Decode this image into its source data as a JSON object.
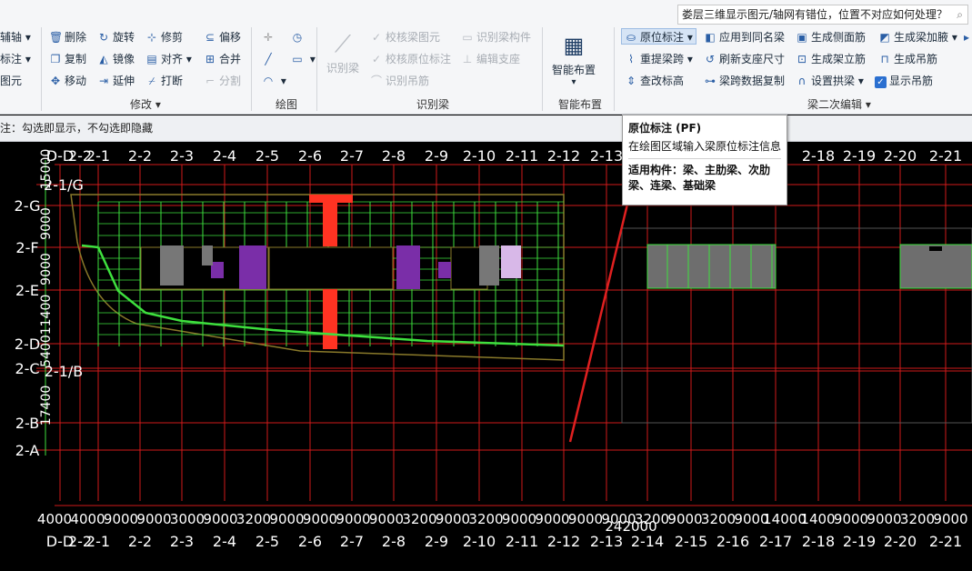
{
  "search": {
    "text": "娄层三维显示图元/轴网有错位，位置不对应如何处理？",
    "icon": "search-icon"
  },
  "ribbon": {
    "partial_left": [
      "辅轴",
      "标注",
      "图元"
    ],
    "modify": {
      "label": "修改",
      "buttons": [
        "删除",
        "旋转",
        "修剪",
        "偏移",
        "复制",
        "镜像",
        "对齐",
        "合并",
        "移动",
        "延伸",
        "打断",
        "分割"
      ]
    },
    "draw": {
      "label": "绘图"
    },
    "identify": {
      "label": "识别梁",
      "big_button": "识别梁",
      "buttons": [
        "校核梁图元",
        "识别梁构件",
        "校核原位标注",
        "编辑支座",
        "识别吊筋"
      ]
    },
    "smart": {
      "label": "智能布置",
      "big_button": "智能布置"
    },
    "beam_edit": {
      "label": "梁二次编辑",
      "buttons": [
        "原位标注",
        "应用到同名梁",
        "生成侧面筋",
        "生成梁加腋",
        "重提梁跨",
        "刷新支座尺寸",
        "生成架立筋",
        "生成吊筋",
        "查改标高",
        "梁跨数据复制",
        "设置拱梁",
        "显示吊筋"
      ]
    }
  },
  "hint": {
    "text": "注：勾选即显示，不勾选即隐藏"
  },
  "tooltip": {
    "title": "原位标注 (PF)",
    "desc": "在绘图区域输入梁原位标注信息",
    "applicable": "适用构件：梁、主肋梁、次肋梁、连梁、基础梁"
  },
  "canvas": {
    "top_axes": [
      "D-D",
      "2-2",
      "2-1",
      "2-2",
      "2-3",
      "2-4",
      "2-5",
      "2-6",
      "2-7",
      "2-8",
      "2-9",
      "2-10",
      "2-11",
      "2-12",
      "2-13",
      "2-18",
      "2-19",
      "2-20",
      "2-21"
    ],
    "bottom_axes": [
      "D-D",
      "2-2",
      "2-1",
      "2-2",
      "2-3",
      "2-4",
      "2-5",
      "2-6",
      "2-7",
      "2-8",
      "2-9",
      "2-10",
      "2-11",
      "2-12",
      "2-13",
      "2-14",
      "2-15",
      "2-16",
      "2-17",
      "2-18",
      "2-19",
      "2-20",
      "2-21"
    ],
    "left_axes": [
      "2-1/G",
      "2-G",
      "2-F",
      "2-E",
      "2-D",
      "2-C",
      "2-1/B",
      "2-B",
      "2-A"
    ],
    "left_dims": [
      "15000",
      "9000",
      "9000",
      "11400",
      "5400",
      "17400"
    ],
    "bottom_dims": [
      "4000",
      "4000",
      "9000",
      "9000",
      "3000",
      "9000",
      "3200",
      "9000",
      "9000",
      "9000",
      "9000",
      "3200",
      "9000",
      "3200",
      "9000",
      "9000",
      "9000",
      "9000",
      "3200",
      "9000",
      "3200",
      "9000",
      "14000",
      "1400",
      "9000",
      "9000",
      "3200",
      "9000"
    ],
    "total_dim": "242000",
    "colors": {
      "grid": "#d11a1a",
      "beam": "#3ee03e",
      "slab": "#8a7a2a",
      "column": "#ff3322",
      "purple": "#7a2ea8",
      "axis_text": "#ffffff"
    }
  }
}
